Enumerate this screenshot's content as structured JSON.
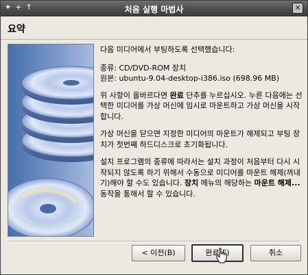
{
  "window": {
    "title": "처음 실행 마법사",
    "titlebar_icons": [
      "✦",
      "+",
      "↑"
    ],
    "close_glyph": "✕"
  },
  "header": {
    "title": "요약"
  },
  "content": {
    "intro": "다음 미디어에서 부팅하도록 선택했습니다:",
    "type_label": "종류:",
    "type_value": "CD/DVD-ROM 장치",
    "source_label": "원본:",
    "source_value": "ubuntu-9.04-desktop-i386.iso (698.96 MB)",
    "para1_a": "위 사항이 올바르다면 ",
    "para1_b": "완료",
    "para1_c": " 단추를 누르십시오. 누른 다음에는 선택한 미디어를 가상 머신에 임시로 마운트하고 가상 머신을 시작합니다.",
    "para2": "가상 머신을 닫으면 지정한 미디어의 마운트가 해제되고 부팅 장치가 첫번째 하드디스크로 초기화됩니다.",
    "para3_a": "설치 프로그램의 종류에 따라서는 설치 과정이 처음부터 다시 시작되지 않도록 하기 위해서 수동으로 미디어를 마운트 해제(꺼내기)해야 할 수도 있습니다. ",
    "para3_b": "장치",
    "para3_c": " 메뉴의 해당하는 ",
    "para3_d": "마운트 해제...",
    "para3_e": " 동작을 통해서 할 수 있습니다."
  },
  "buttons": {
    "back": "< 이전(B)",
    "finish": "완료(F)",
    "cancel": "취소"
  }
}
